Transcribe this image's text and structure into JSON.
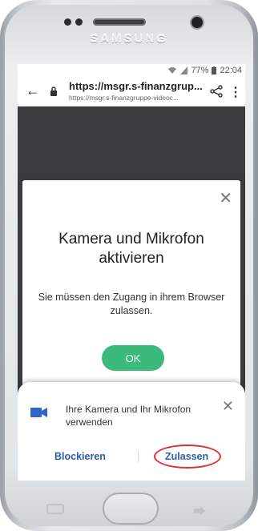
{
  "device": {
    "brand": "SAMSUNG"
  },
  "statusbar": {
    "battery_percent": "77%",
    "time": "22:04",
    "icons": [
      "wifi-icon",
      "signal-icon",
      "battery-icon"
    ]
  },
  "browser": {
    "url_main": "https://msgr.s-finanzgrup...",
    "url_sub": "https://msgr.s-finanzgruppe-videoc...",
    "back_icon": "arrow-left-icon",
    "lock_icon": "lock-icon",
    "share_icon": "share-icon",
    "menu_icon": "more-vertical-icon"
  },
  "modal": {
    "title": "Kamera und Mikrofon aktivieren",
    "message": "Sie müssen den Zugang in ihrem Browser zulassen.",
    "ok_label": "OK",
    "close_icon": "close-icon"
  },
  "permission_sheet": {
    "text": "Ihre Kamera und Ihr Mikrofon verwenden",
    "block_label": "Blockieren",
    "allow_label": "Zulassen",
    "icon": "video-camera-icon",
    "close_icon": "close-icon"
  },
  "colors": {
    "ok_button": "#3cba7e",
    "link_blue": "#2e5ea8",
    "highlight_ring": "#e0303a",
    "camera_icon": "#2f64c8"
  }
}
